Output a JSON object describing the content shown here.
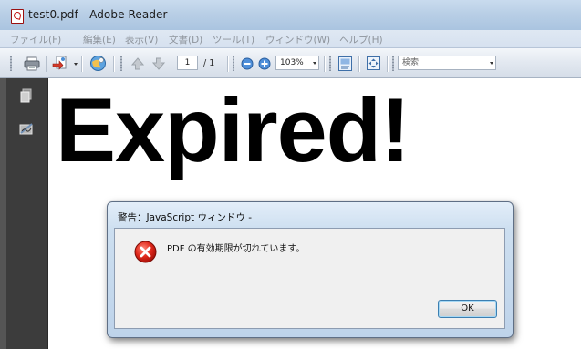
{
  "window": {
    "title": "test0.pdf - Adobe Reader"
  },
  "menu": {
    "items": [
      {
        "label": "ファイル(F)"
      },
      {
        "label": "編集(E)"
      },
      {
        "label": "表示(V)"
      },
      {
        "label": "文書(D)"
      },
      {
        "label": "ツール(T)"
      },
      {
        "label": "ウィンドウ(W)"
      },
      {
        "label": "ヘルプ(H)"
      }
    ]
  },
  "toolbar": {
    "page_current": "1",
    "page_total": "/ 1",
    "zoom": "103%",
    "search_placeholder": "検索",
    "icons": [
      "print-icon",
      "create-pdf-icon",
      "collaborate-icon",
      "previous-page-icon",
      "next-page-icon",
      "zoom-out-icon",
      "zoom-in-icon",
      "fit-page-icon",
      "fit-width-icon"
    ]
  },
  "navpanel": {
    "icons": [
      "pages-icon",
      "signatures-icon"
    ]
  },
  "document": {
    "headline": "Expired!"
  },
  "dialog": {
    "title": "警告：JavaScript ウィンドウ -",
    "message": "PDF の有効期限が切れています。",
    "ok_label": "OK",
    "icon": "error-icon"
  }
}
